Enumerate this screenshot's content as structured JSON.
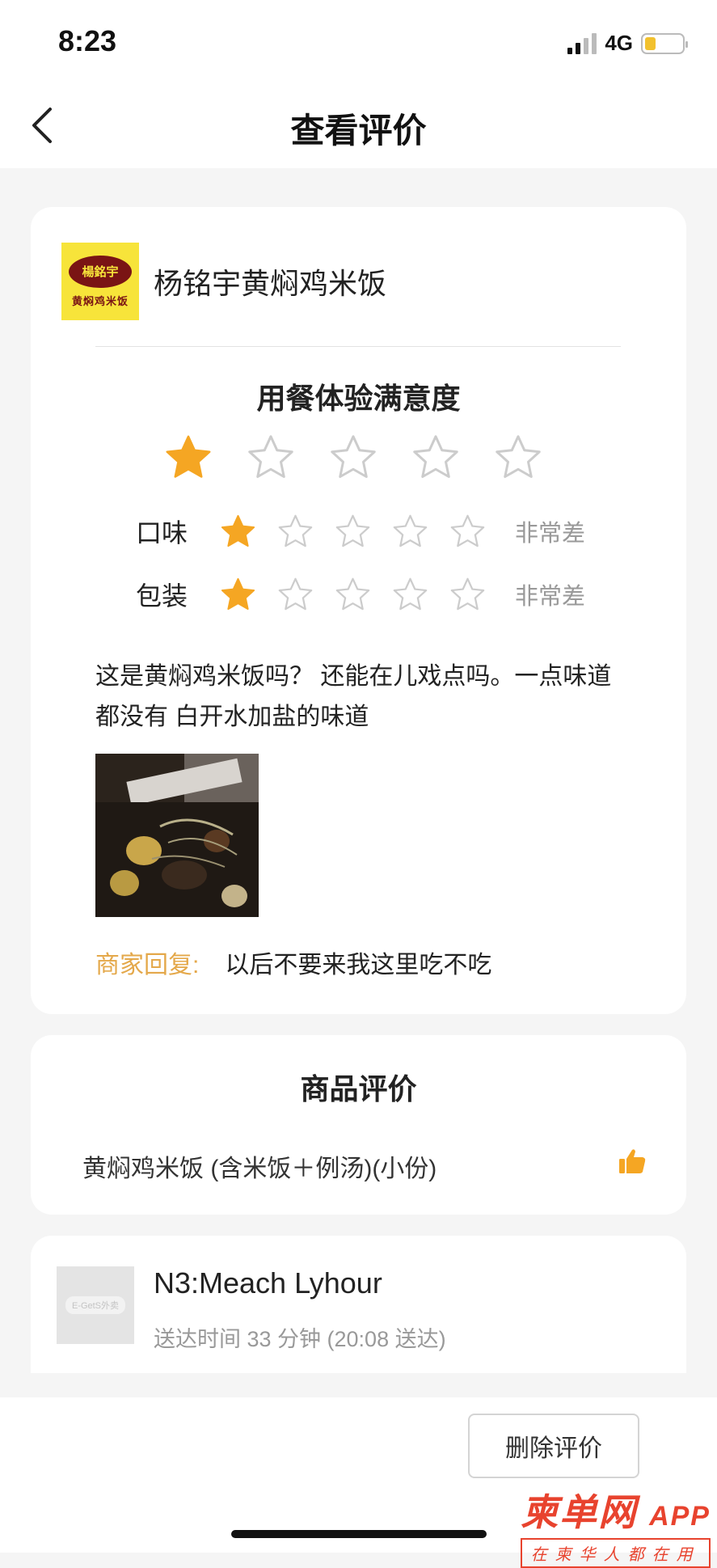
{
  "status_bar": {
    "time": "8:23",
    "network": "4G",
    "battery_level": 0.3
  },
  "nav": {
    "back_icon": "chevron-left-icon",
    "title": "查看评价"
  },
  "shop": {
    "logo_text": "楊銘宇",
    "logo_subtext": "黄焖鸡米饭",
    "name": "杨铭宇黄焖鸡米饭"
  },
  "dining_experience": {
    "title": "用餐体验满意度",
    "rating": 1,
    "max": 5
  },
  "ratings": [
    {
      "label": "口味",
      "rating": 1,
      "max": 5,
      "text": "非常差"
    },
    {
      "label": "包装",
      "rating": 1,
      "max": 5,
      "text": "非常差"
    }
  ],
  "review": {
    "text": "这是黄焖鸡米饭吗？ 还能在儿戏点吗。一点味道都没有 白开水加盐的味道"
  },
  "merchant_reply": {
    "label": "商家回复:",
    "text": "以后不要来我这里吃不吃"
  },
  "goods_review": {
    "title": "商品评价",
    "item": "黄焖鸡米饭 (含米饭＋例汤)(小份)",
    "icon": "thumbs-up-icon"
  },
  "rider": {
    "avatar_text": "E-GetS外卖",
    "name": "N3:Meach Lyhour",
    "delivery_time": "送达时间 33 分钟 (20:08 送达)"
  },
  "actions": {
    "delete_label": "删除评价"
  },
  "watermark": {
    "logo": "柬单网",
    "app": "APP",
    "slogan": "在柬华人都在用"
  },
  "colors": {
    "star_active": "#f5a623",
    "star_inactive": "#cccccc",
    "reply_label": "#e4a84a",
    "watermark": "#e8432e"
  }
}
